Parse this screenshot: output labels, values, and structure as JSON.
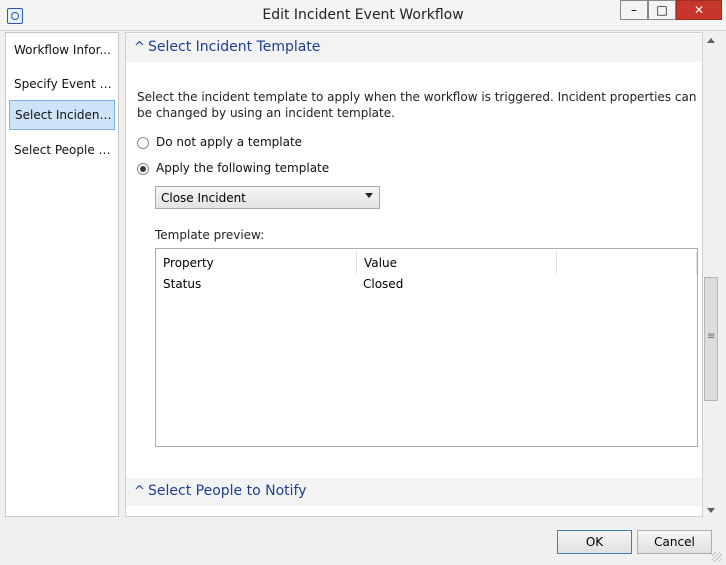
{
  "window": {
    "title": "Edit Incident Event Workflow",
    "minimize_label": "–",
    "maximize_label": "□",
    "close_label": "✕"
  },
  "sidebar": {
    "items": [
      {
        "label": "Workflow Infor...",
        "selected": false
      },
      {
        "label": "Specify Event Cri...",
        "selected": false
      },
      {
        "label": "Select Incident T...",
        "selected": true
      },
      {
        "label": "Select People to...",
        "selected": false
      }
    ]
  },
  "sections": {
    "template": {
      "title": "Select Incident Template",
      "description": "Select the incident template to apply when the workflow is triggered. Incident properties can be changed by using an incident template.",
      "radio_none_label": "Do not apply a template",
      "radio_apply_label": "Apply the following template",
      "selected_radio": "apply",
      "dropdown_value": "Close Incident",
      "preview_label": "Template preview:",
      "preview_columns": [
        "Property",
        "Value",
        ""
      ],
      "preview_rows": [
        {
          "property": "Status",
          "value": "Closed"
        }
      ]
    },
    "notify": {
      "title": "Select People to Notify"
    }
  },
  "footer": {
    "ok_label": "OK",
    "cancel_label": "Cancel"
  },
  "icons": {
    "app": "workflow-app-icon",
    "collapse": "chevron-up-icon",
    "dropdown": "dropdown-arrow-icon"
  }
}
